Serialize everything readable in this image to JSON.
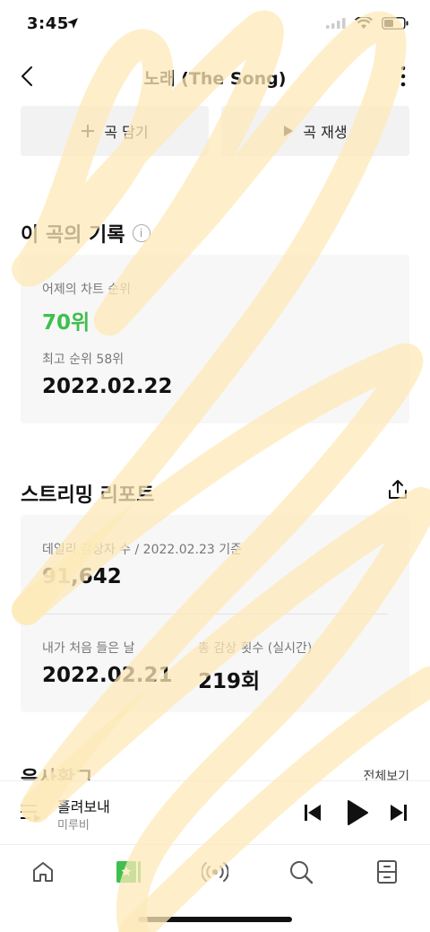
{
  "status_bar": {
    "time": "3:45"
  },
  "nav": {
    "title": "노래 (The Song)"
  },
  "actions": {
    "add_label": "곡 담기",
    "play_label": "곡 재생"
  },
  "record_section": {
    "title": "이 곡의 기록",
    "yesterday_rank_label": "어제의 차트 순위",
    "yesterday_rank": "70위",
    "best_rank_label": "최고 순위 58위",
    "best_rank_date": "2022.02.22"
  },
  "streaming_section": {
    "title": "스트리밍 리포트",
    "daily_listeners_label": "데일리 감상자 수 / 2022.02.23 기준",
    "daily_listeners": "91,642",
    "first_listen_label": "내가 처음 들은 날",
    "first_listen_date": "2022.02.21",
    "total_plays_label": "총 감상 횟수 (실시간)",
    "total_plays": "219회"
  },
  "next_section": {
    "title": "음사확그",
    "more_link": "전체보기"
  },
  "mini_player": {
    "title": "흘려보내",
    "artist": "미루비"
  },
  "colors": {
    "accent_green": "#3fbf4e",
    "highlight_scribble": "#fde9b8"
  },
  "icons": {
    "tabs": [
      "home-icon",
      "my-music-icon",
      "radio-icon",
      "search-icon",
      "library-icon"
    ]
  }
}
